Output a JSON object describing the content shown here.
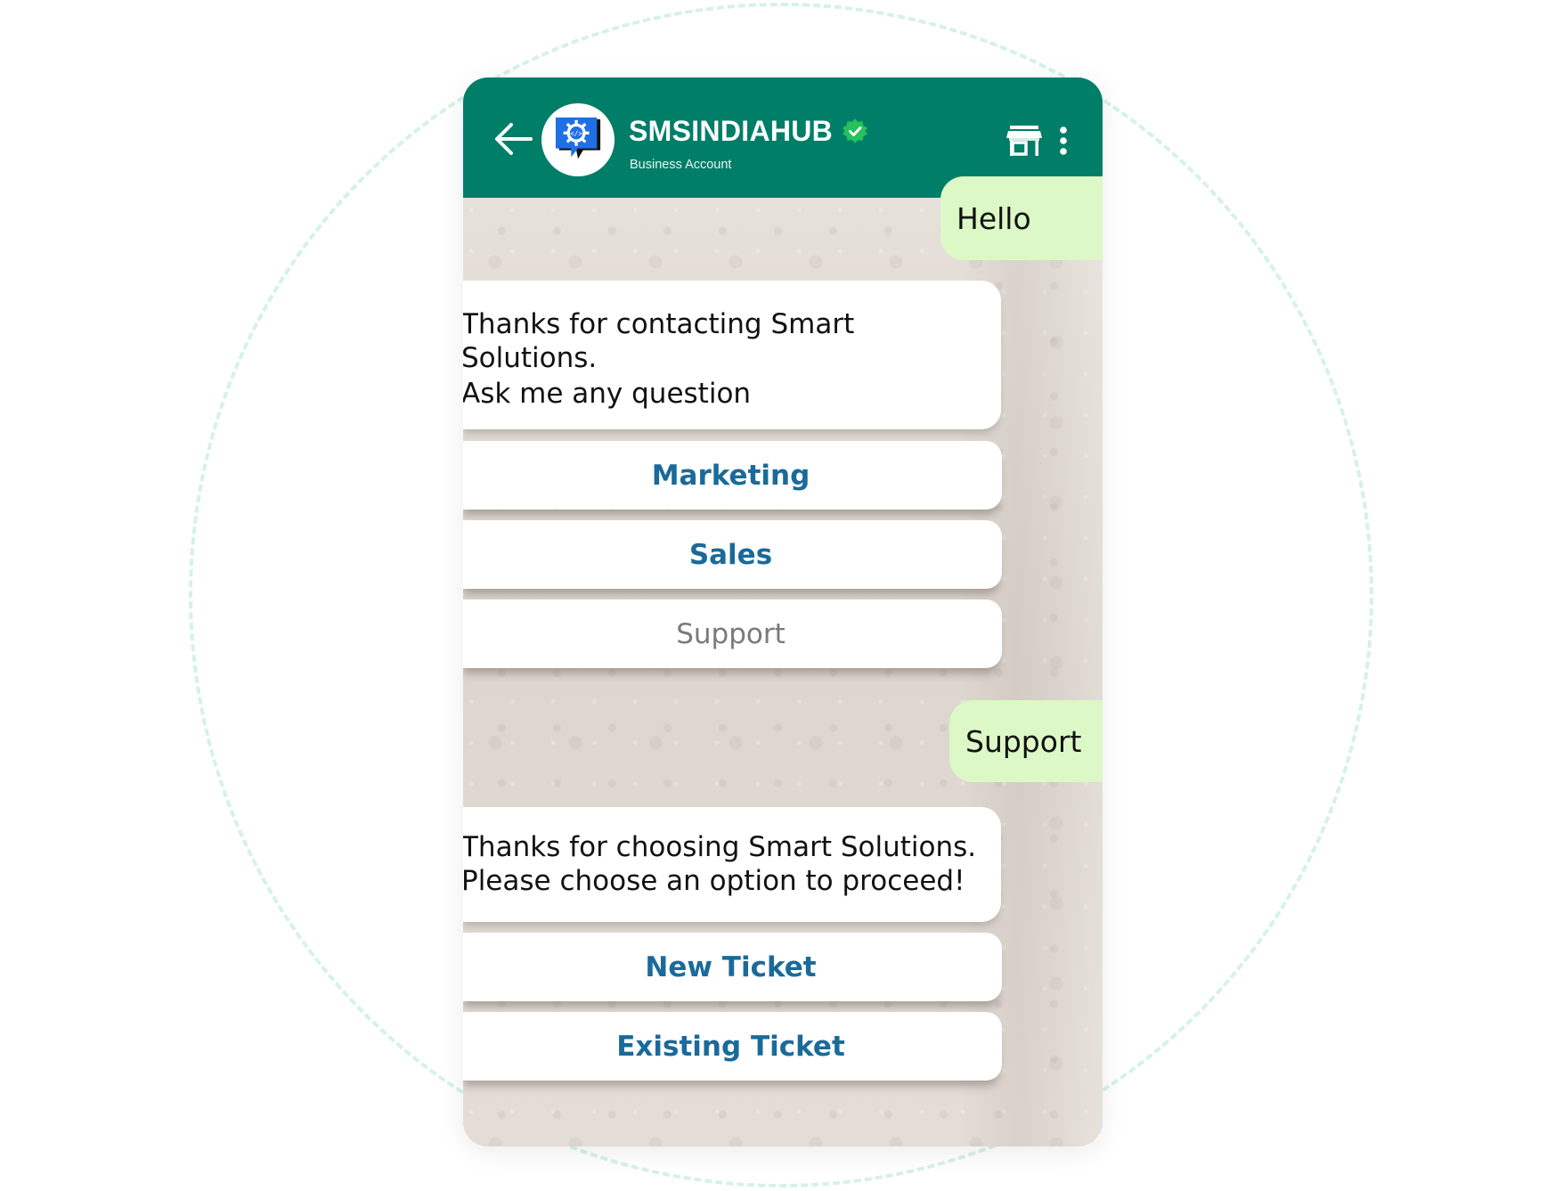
{
  "header": {
    "title": "SMSINDIAHUB",
    "subtitle": "Business Account",
    "verified": true,
    "icons": [
      "back-arrow-icon",
      "avatar-logo",
      "verified-badge-icon",
      "store-icon",
      "more-options-icon"
    ]
  },
  "colors": {
    "header": "#017e68",
    "outgoing_bubble": "#dcf8c6",
    "incoming_bubble": "#ffffff",
    "button_text": "#1a6a9a",
    "button_text_disabled": "#7a7a7a",
    "verified": "#25c15a",
    "avatar_logo": "#1f6fe5"
  },
  "messages": [
    {
      "type": "outgoing",
      "text": "Hello"
    },
    {
      "type": "incoming",
      "lines": [
        "Thanks for contacting Smart",
        "Solutions.",
        "Ask me any question"
      ],
      "buttons": [
        {
          "label": "Marketing",
          "state": "active"
        },
        {
          "label": "Sales",
          "state": "active"
        },
        {
          "label": "Support",
          "state": "disabled"
        }
      ]
    },
    {
      "type": "outgoing",
      "text": "Support"
    },
    {
      "type": "incoming",
      "lines": [
        "Thanks for choosing Smart Solutions.",
        "Please choose an option to proceed!"
      ],
      "buttons": [
        {
          "label": "New Ticket",
          "state": "active"
        },
        {
          "label": "Existing Ticket",
          "state": "active"
        }
      ]
    }
  ]
}
